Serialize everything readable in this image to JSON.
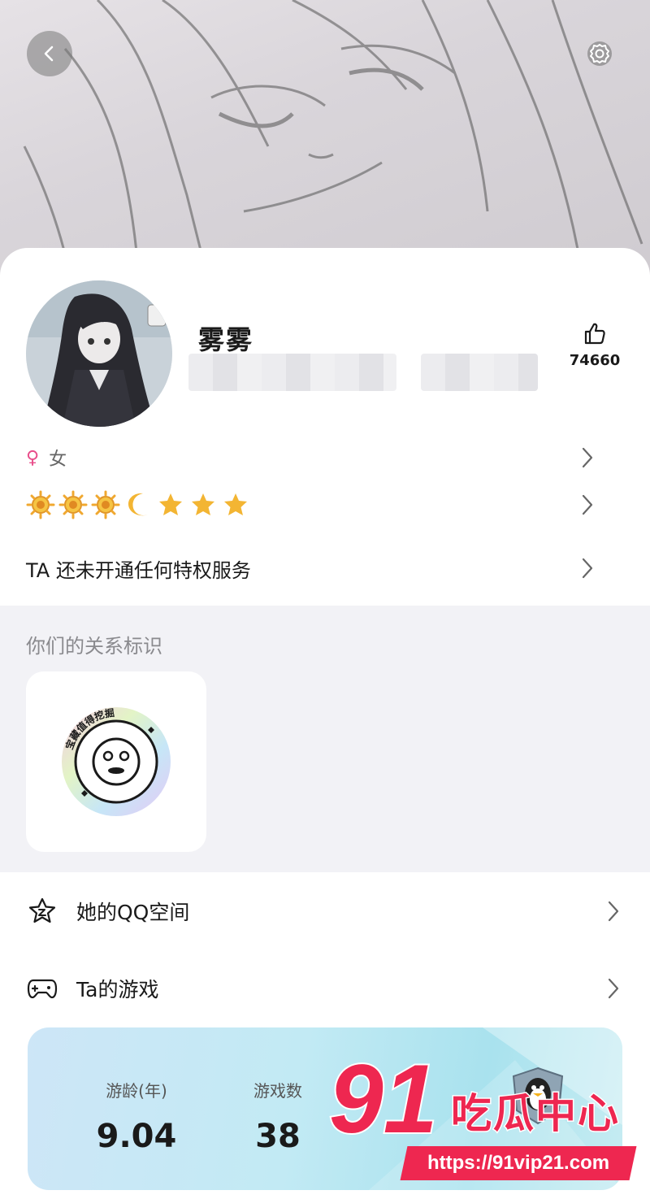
{
  "header": {
    "back_icon": "chevron-left-icon",
    "settings_icon": "gear-icon"
  },
  "profile": {
    "name": "雾雾",
    "likes": "74660",
    "gender_symbol": "♀",
    "gender": "女",
    "level_icons": [
      "sun",
      "sun",
      "sun",
      "moon",
      "star",
      "star",
      "star"
    ],
    "privilege_text": "TA 还未开通任何特权服务"
  },
  "relationship": {
    "title": "你们的关系标识",
    "badge_text": "宝藏值得挖掘"
  },
  "menu": {
    "qzone": "她的QQ空间",
    "games": "Ta的游戏"
  },
  "game_card": {
    "stats": [
      {
        "label": "游龄(年)",
        "value": "9.04"
      },
      {
        "label": "游戏数",
        "value": "38"
      }
    ]
  },
  "watermark": {
    "number": "91",
    "text": "吃瓜中心",
    "url": "https://91vip21.com"
  },
  "colors": {
    "accent_pink": "#e84d8a",
    "watermark_red": "#ee2750",
    "level_gold": "#f3b533"
  }
}
